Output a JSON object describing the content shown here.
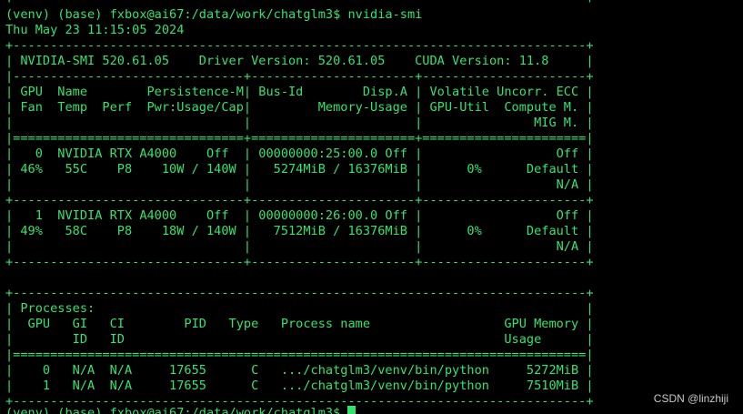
{
  "terminal": {
    "lines": [
      "+-----------------------------------------------------------------------------+",
      "(venv) (base) fxbox@ai67:/data/work/chatglm3$ nvidia-smi",
      "Thu May 23 11:15:05 2024",
      "+-----------------------------------------------------------------------------+",
      "| NVIDIA-SMI 520.61.05    Driver Version: 520.61.05    CUDA Version: 11.8     |",
      "|-------------------------------+----------------------+----------------------+",
      "| GPU  Name        Persistence-M| Bus-Id        Disp.A | Volatile Uncorr. ECC |",
      "| Fan  Temp  Perf  Pwr:Usage/Cap|         Memory-Usage | GPU-Util  Compute M. |",
      "|                               |                      |               MIG M. |",
      "|===============================+======================+======================|",
      "|   0  NVIDIA RTX A4000    Off  | 00000000:25:00.0 Off |                  Off |",
      "| 46%   55C    P8    10W / 140W |   5274MiB / 16376MiB |      0%      Default |",
      "|                               |                      |                  N/A |",
      "+-------------------------------+----------------------+----------------------+",
      "|   1  NVIDIA RTX A4000    Off  | 00000000:26:00.0 Off |                  Off |",
      "| 49%   58C    P8    18W / 140W |   7512MiB / 16376MiB |      0%      Default |",
      "|                               |                      |                  N/A |",
      "+-------------------------------+----------------------+----------------------+",
      "",
      "+-----------------------------------------------------------------------------+",
      "| Processes:                                                                  |",
      "|  GPU   GI   CI        PID   Type   Process name                  GPU Memory |",
      "|        ID   ID                                                   Usage      |",
      "|=============================================================================|",
      "|    0   N/A  N/A     17655      C   .../chatglm3/venv/bin/python     5272MiB |",
      "|    1   N/A  N/A     17655      C   .../chatglm3/venv/bin/python     7510MiB |",
      "+-----------------------------------------------------------------------------+",
      "(venv) (base) fxbox@ai67:/data/work/chatglm3$ "
    ],
    "text_color": "#33e36e",
    "background": "#000000"
  },
  "watermark": "CSDN @linzhiji"
}
